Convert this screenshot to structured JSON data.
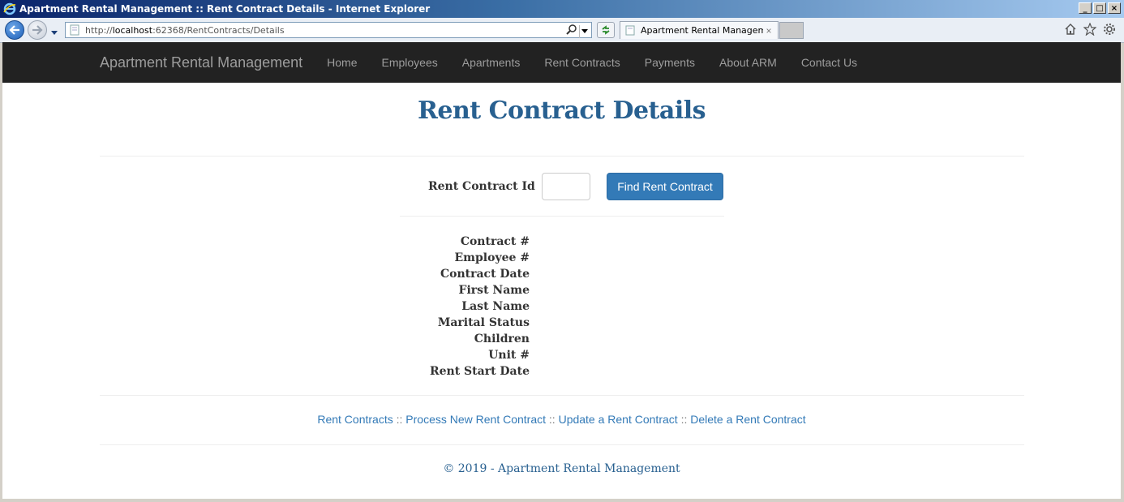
{
  "window": {
    "title": "Apartment Rental Management :: Rent Contract Details - Internet Explorer",
    "controls": [
      "_",
      "□",
      "×"
    ]
  },
  "browser": {
    "address_prefix": "http://",
    "address_host": "localhost",
    "address_rest": ":62368/RentContracts/Details",
    "tab_title": "Apartment Rental Managem...",
    "tab_close": "×"
  },
  "navbar": {
    "brand": "Apartment Rental Management",
    "links": [
      "Home",
      "Employees",
      "Apartments",
      "Rent Contracts",
      "Payments",
      "About ARM",
      "Contact Us"
    ]
  },
  "page": {
    "title": "Rent Contract Details",
    "id_label": "Rent Contract Id",
    "id_value": "",
    "find_button": "Find Rent Contract",
    "detail_labels": [
      "Contract #",
      "Employee #",
      "Contract Date",
      "First Name",
      "Last Name",
      "Marital Status",
      "Children",
      "Unit #",
      "Rent Start Date"
    ]
  },
  "footer": {
    "links": [
      "Rent Contracts",
      "Process New Rent Contract",
      "Update a Rent Contract",
      "Delete a Rent Contract"
    ],
    "separator": "::",
    "copyright": "© 2019 - Apartment Rental Management"
  }
}
